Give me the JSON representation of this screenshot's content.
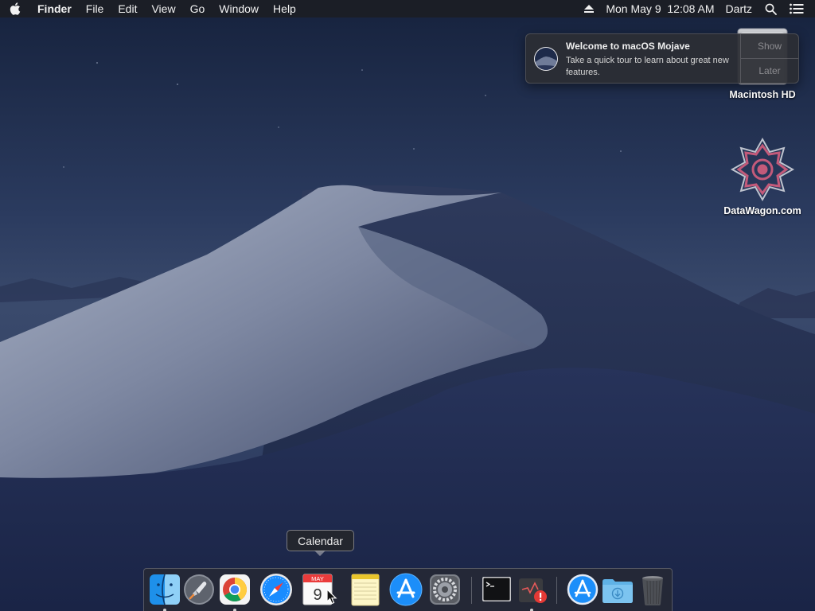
{
  "menubar": {
    "apple_icon": "apple-icon",
    "app_name": "Finder",
    "items": [
      "File",
      "Edit",
      "View",
      "Go",
      "Window",
      "Help"
    ],
    "clock": "Mon May 9  12:08 AM",
    "user": "Dartz",
    "status_icons": [
      "eject-icon",
      "spotlight-search-icon",
      "notification-center-icon"
    ]
  },
  "notification": {
    "title": "Welcome to macOS Mojave",
    "body": "Take a quick tour to learn about great new features.",
    "actions": {
      "show": "Show",
      "later": "Later"
    }
  },
  "desktop_icons": [
    {
      "label": "Macintosh HD",
      "icon": "hard-drive-icon"
    },
    {
      "label": "DataWagon.com",
      "icon": "datawagon-logo-icon"
    }
  ],
  "dock": {
    "tooltip": "Calendar",
    "calendar": {
      "month": "MAY",
      "day": "9"
    },
    "items": [
      {
        "name": "Finder",
        "icon": "finder-icon",
        "running": true
      },
      {
        "name": "Launchpad",
        "icon": "launchpad-icon",
        "running": false
      },
      {
        "name": "Google Chrome",
        "icon": "chrome-icon",
        "running": true
      },
      {
        "name": "Safari",
        "icon": "safari-icon",
        "running": false
      },
      {
        "name": "Calendar",
        "icon": "calendar-icon",
        "running": false
      },
      {
        "name": "Notes",
        "icon": "notes-icon",
        "running": false
      },
      {
        "name": "App Store",
        "icon": "app-store-icon",
        "running": false
      },
      {
        "name": "System Preferences",
        "icon": "system-preferences-icon",
        "running": false
      },
      {
        "name": "Terminal",
        "icon": "terminal-icon",
        "running": false
      },
      {
        "name": "Crash Reporter",
        "icon": "crash-reporter-icon",
        "running": true
      },
      {
        "name": "Applications",
        "icon": "applications-folder-icon",
        "running": false
      },
      {
        "name": "Downloads",
        "icon": "downloads-folder-icon",
        "running": false
      },
      {
        "name": "Trash",
        "icon": "trash-icon",
        "running": false
      }
    ]
  },
  "colors": {
    "menubar_bg": "#1c1e24",
    "notification_bg": "#2c2e34",
    "dock_bg": "#282a30"
  }
}
